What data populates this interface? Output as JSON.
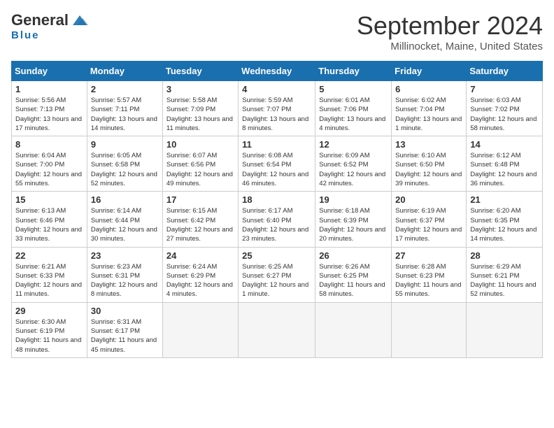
{
  "logo": {
    "general": "General",
    "blue": "Blue"
  },
  "title": "September 2024",
  "subtitle": "Millinocket, Maine, United States",
  "days_of_week": [
    "Sunday",
    "Monday",
    "Tuesday",
    "Wednesday",
    "Thursday",
    "Friday",
    "Saturday"
  ],
  "weeks": [
    [
      {
        "day": "1",
        "sunrise": "5:56 AM",
        "sunset": "7:13 PM",
        "daylight": "13 hours and 17 minutes."
      },
      {
        "day": "2",
        "sunrise": "5:57 AM",
        "sunset": "7:11 PM",
        "daylight": "13 hours and 14 minutes."
      },
      {
        "day": "3",
        "sunrise": "5:58 AM",
        "sunset": "7:09 PM",
        "daylight": "13 hours and 11 minutes."
      },
      {
        "day": "4",
        "sunrise": "5:59 AM",
        "sunset": "7:07 PM",
        "daylight": "13 hours and 8 minutes."
      },
      {
        "day": "5",
        "sunrise": "6:01 AM",
        "sunset": "7:06 PM",
        "daylight": "13 hours and 4 minutes."
      },
      {
        "day": "6",
        "sunrise": "6:02 AM",
        "sunset": "7:04 PM",
        "daylight": "13 hours and 1 minute."
      },
      {
        "day": "7",
        "sunrise": "6:03 AM",
        "sunset": "7:02 PM",
        "daylight": "12 hours and 58 minutes."
      }
    ],
    [
      {
        "day": "8",
        "sunrise": "6:04 AM",
        "sunset": "7:00 PM",
        "daylight": "12 hours and 55 minutes."
      },
      {
        "day": "9",
        "sunrise": "6:05 AM",
        "sunset": "6:58 PM",
        "daylight": "12 hours and 52 minutes."
      },
      {
        "day": "10",
        "sunrise": "6:07 AM",
        "sunset": "6:56 PM",
        "daylight": "12 hours and 49 minutes."
      },
      {
        "day": "11",
        "sunrise": "6:08 AM",
        "sunset": "6:54 PM",
        "daylight": "12 hours and 46 minutes."
      },
      {
        "day": "12",
        "sunrise": "6:09 AM",
        "sunset": "6:52 PM",
        "daylight": "12 hours and 42 minutes."
      },
      {
        "day": "13",
        "sunrise": "6:10 AM",
        "sunset": "6:50 PM",
        "daylight": "12 hours and 39 minutes."
      },
      {
        "day": "14",
        "sunrise": "6:12 AM",
        "sunset": "6:48 PM",
        "daylight": "12 hours and 36 minutes."
      }
    ],
    [
      {
        "day": "15",
        "sunrise": "6:13 AM",
        "sunset": "6:46 PM",
        "daylight": "12 hours and 33 minutes."
      },
      {
        "day": "16",
        "sunrise": "6:14 AM",
        "sunset": "6:44 PM",
        "daylight": "12 hours and 30 minutes."
      },
      {
        "day": "17",
        "sunrise": "6:15 AM",
        "sunset": "6:42 PM",
        "daylight": "12 hours and 27 minutes."
      },
      {
        "day": "18",
        "sunrise": "6:17 AM",
        "sunset": "6:40 PM",
        "daylight": "12 hours and 23 minutes."
      },
      {
        "day": "19",
        "sunrise": "6:18 AM",
        "sunset": "6:39 PM",
        "daylight": "12 hours and 20 minutes."
      },
      {
        "day": "20",
        "sunrise": "6:19 AM",
        "sunset": "6:37 PM",
        "daylight": "12 hours and 17 minutes."
      },
      {
        "day": "21",
        "sunrise": "6:20 AM",
        "sunset": "6:35 PM",
        "daylight": "12 hours and 14 minutes."
      }
    ],
    [
      {
        "day": "22",
        "sunrise": "6:21 AM",
        "sunset": "6:33 PM",
        "daylight": "12 hours and 11 minutes."
      },
      {
        "day": "23",
        "sunrise": "6:23 AM",
        "sunset": "6:31 PM",
        "daylight": "12 hours and 8 minutes."
      },
      {
        "day": "24",
        "sunrise": "6:24 AM",
        "sunset": "6:29 PM",
        "daylight": "12 hours and 4 minutes."
      },
      {
        "day": "25",
        "sunrise": "6:25 AM",
        "sunset": "6:27 PM",
        "daylight": "12 hours and 1 minute."
      },
      {
        "day": "26",
        "sunrise": "6:26 AM",
        "sunset": "6:25 PM",
        "daylight": "11 hours and 58 minutes."
      },
      {
        "day": "27",
        "sunrise": "6:28 AM",
        "sunset": "6:23 PM",
        "daylight": "11 hours and 55 minutes."
      },
      {
        "day": "28",
        "sunrise": "6:29 AM",
        "sunset": "6:21 PM",
        "daylight": "11 hours and 52 minutes."
      }
    ],
    [
      {
        "day": "29",
        "sunrise": "6:30 AM",
        "sunset": "6:19 PM",
        "daylight": "11 hours and 48 minutes."
      },
      {
        "day": "30",
        "sunrise": "6:31 AM",
        "sunset": "6:17 PM",
        "daylight": "11 hours and 45 minutes."
      },
      null,
      null,
      null,
      null,
      null
    ]
  ],
  "labels": {
    "sunrise": "Sunrise:",
    "sunset": "Sunset:",
    "daylight": "Daylight:"
  }
}
